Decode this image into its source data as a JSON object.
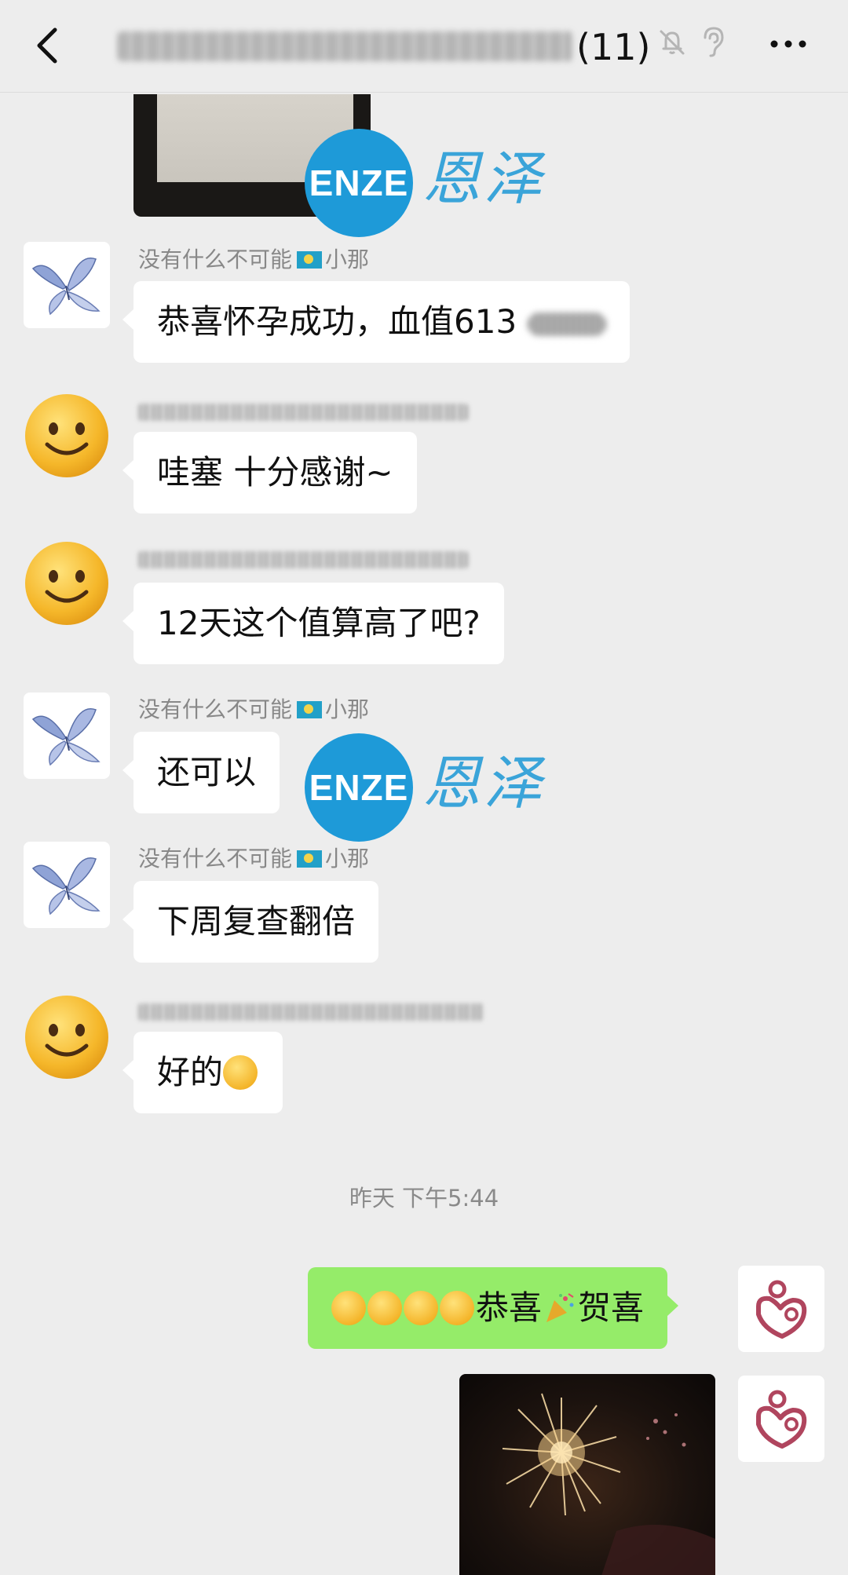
{
  "header": {
    "title_count": "(11)"
  },
  "watermark": {
    "logo_text": "ENZE",
    "cn_text": "恩泽"
  },
  "messages": [
    {
      "sender": "没有什么不可能",
      "sender_suffix": "小那",
      "text": "恭喜怀孕成功，血值613"
    },
    {
      "text": "哇塞 十分感谢~"
    },
    {
      "text": "12天这个值算高了吧?"
    },
    {
      "sender": "没有什么不可能",
      "sender_suffix": "小那",
      "text": "还可以"
    },
    {
      "sender": "没有什么不可能",
      "sender_suffix": "小那",
      "text": "下周复查翻倍"
    },
    {
      "text": "好的"
    }
  ],
  "timestamp": "昨天 下午5:44",
  "outgoing": {
    "part1": "恭喜",
    "part2": "贺喜"
  },
  "colors": {
    "background": "#ededed",
    "outgoing_bubble": "#95ec69",
    "incoming_bubble": "#ffffff",
    "brand_blue": "#1e9ad8"
  }
}
